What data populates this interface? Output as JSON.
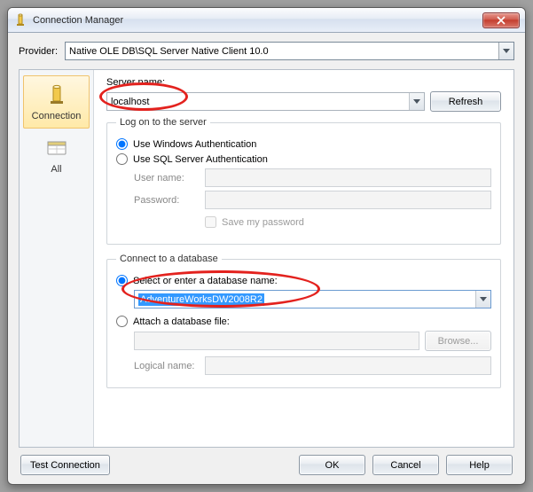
{
  "window": {
    "title": "Connection Manager"
  },
  "provider": {
    "label": "Provider:",
    "value": "Native OLE DB\\SQL Server Native Client 10.0"
  },
  "sidebar": {
    "items": [
      {
        "label": "Connection",
        "selected": true
      },
      {
        "label": "All",
        "selected": false
      }
    ]
  },
  "server": {
    "label": "Server name:",
    "value": "localhost",
    "refresh": "Refresh"
  },
  "logon": {
    "legend": "Log on to the server",
    "opt_windows": "Use Windows Authentication",
    "opt_sql": "Use SQL Server Authentication",
    "user_label": "User name:",
    "user_value": "",
    "pass_label": "Password:",
    "pass_value": "",
    "save_pw": "Save my password"
  },
  "database": {
    "legend": "Connect to a database",
    "opt_select": "Select or enter a database name:",
    "db_value": "AdventureWorksDW2008R2",
    "opt_attach": "Attach a database file:",
    "attach_value": "",
    "browse": "Browse...",
    "logical_label": "Logical name:",
    "logical_value": ""
  },
  "footer": {
    "test": "Test Connection",
    "ok": "OK",
    "cancel": "Cancel",
    "help": "Help"
  }
}
